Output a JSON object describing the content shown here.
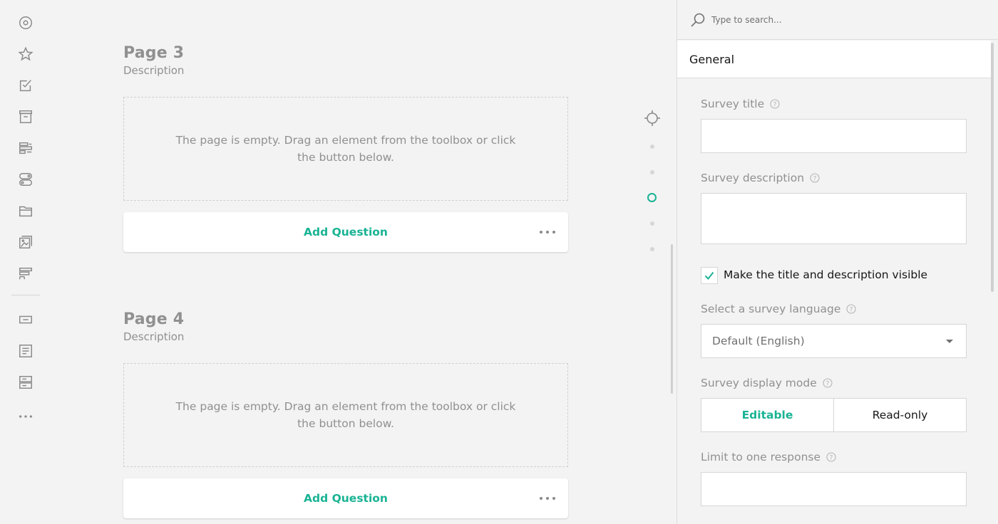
{
  "toolbox": {
    "items": [
      {
        "name": "radiogroup-icon"
      },
      {
        "name": "rating-icon"
      },
      {
        "name": "checkbox-icon"
      },
      {
        "name": "dropdown-icon"
      },
      {
        "name": "tagbox-icon"
      },
      {
        "name": "boolean-icon"
      },
      {
        "name": "file-icon"
      },
      {
        "name": "imagepicker-icon"
      },
      {
        "name": "ranking-icon"
      },
      {
        "name": "text-icon"
      },
      {
        "name": "comment-icon"
      },
      {
        "name": "multipletext-icon"
      },
      {
        "name": "more-icon"
      }
    ]
  },
  "pages": [
    {
      "title": "Page 3",
      "description": "Description",
      "empty_message": "The page is empty. Drag an element from the toolbox or click the button below.",
      "add_question_label": "Add Question"
    },
    {
      "title": "Page 4",
      "description": "Description",
      "empty_message": "The page is empty. Drag an element from the toolbox or click the button below.",
      "add_question_label": "Add Question"
    }
  ],
  "navigator": {
    "page_count": 5,
    "current_index": 2
  },
  "property_grid": {
    "search_placeholder": "Type to search...",
    "category": "General",
    "survey_title_label": "Survey title",
    "survey_title_value": "",
    "survey_description_label": "Survey description",
    "survey_description_value": "",
    "visible_checkbox_label": "Make the title and description visible",
    "visible_checked": true,
    "language_label": "Select a survey language",
    "language_value": "Default (English)",
    "display_mode_label": "Survey display mode",
    "display_mode_options": [
      "Editable",
      "Read-only"
    ],
    "display_mode_selected": "Editable",
    "limit_label": "Limit to one response",
    "limit_value": ""
  },
  "colors": {
    "accent": "#19b394",
    "muted_text": "#909090",
    "background": "#f3f3f3"
  }
}
